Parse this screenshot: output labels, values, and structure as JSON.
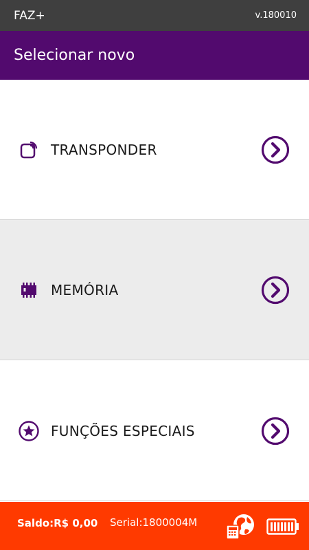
{
  "status_bar": {
    "app_name": "FAZ+",
    "version": "v.180010"
  },
  "title_bar": {
    "title": "Selecionar novo"
  },
  "menu": {
    "items": [
      {
        "label": "TRANSPONDER",
        "icon": "transponder-icon"
      },
      {
        "label": "MEMÓRIA",
        "icon": "memory-chip-icon"
      },
      {
        "label": "FUNÇÕES ESPECIAIS",
        "icon": "star-icon"
      }
    ]
  },
  "footer": {
    "saldo": "Saldo:R$ 0,00",
    "serial": "Serial:1800004M",
    "network_icon": "globe-network-icon",
    "battery_icon": "battery-icon"
  },
  "colors": {
    "status_bar": "#3f3f3f",
    "title_bar": "#520a6e",
    "accent": "#520a6e",
    "footer": "#ff3a00",
    "alt_row": "#ececec"
  }
}
